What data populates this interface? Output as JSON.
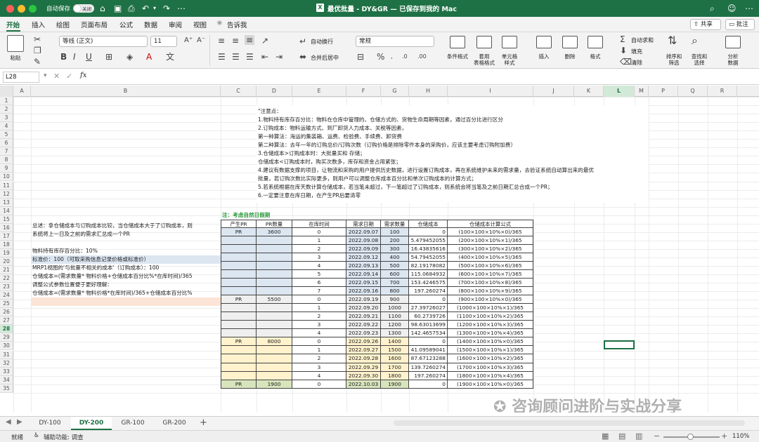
{
  "titlebar": {
    "autosave": "自动保存",
    "autosave_state": "关闭",
    "doc_title": "最优批量 - DY&GR — 已保存到我的 Mac",
    "share": "共享",
    "comment": "批注"
  },
  "ribbon_tabs": [
    "开始",
    "插入",
    "绘图",
    "页面布局",
    "公式",
    "数据",
    "审阅",
    "视图"
  ],
  "tell_me": "告诉我",
  "ribbon": {
    "paste": "粘贴",
    "font_name": "等线 (正文)",
    "font_size": "11",
    "wrap": "自动换行",
    "merge": "合并后居中",
    "number_format": "常规",
    "cond_format": "条件格式",
    "table_format": "套用\n表格格式",
    "cell_style": "单元格\n样式",
    "insert": "插入",
    "delete": "删除",
    "format": "格式",
    "autosum": "自动求和",
    "fill": "填充",
    "clear": "清除",
    "sort": "排序和\n筛选",
    "find": "查找和\n选择",
    "analyze": "分析\n数据"
  },
  "formula_bar": {
    "name_box": "L28",
    "fx": "fx",
    "value": ""
  },
  "columns": [
    "A",
    "B",
    "C",
    "D",
    "E",
    "F",
    "G",
    "H",
    "I",
    "J",
    "K",
    "L",
    "M",
    "P",
    "Q",
    "R"
  ],
  "rows": [
    "1",
    "2",
    "3",
    "4",
    "5",
    "6",
    "7",
    "8",
    "9",
    "10",
    "11",
    "12",
    "13",
    "14",
    "15",
    "16",
    "17",
    "18",
    "19",
    "20",
    "21",
    "22",
    "23",
    "24",
    "25",
    "26",
    "27",
    "28",
    "29",
    "30",
    "31",
    "32",
    "33",
    "34",
    "35"
  ],
  "left_notes": [
    "总述：拿仓储成本与订购成本比较，当仓储成本大于了订购成本，则",
    "系统将上一日及之前的需求汇总成一个PR",
    "物料持有库存百分比：10%",
    "标准价：100（可取采购信息记录价格或标准价）",
    "MRP1视图的'与批量不相关的成本'（订购成本）：100",
    "仓储成本=(需求数量* 物料价格+仓储成本百分比%*在库时间)/365",
    "调整公式参数位置便于更好理解：",
    "仓储成本=(需求数量* 物料价格*在库时间)/365+仓储成本百分比%"
  ],
  "right_notes": [
    "\"注意点：",
    "1.物料持有库存百分比：物料在仓库中管理的、仓储方式的、货物生命周期等因素，通过百分比进行区分",
    "2.订购成本：物料运输方式、到厂卸货人力成本、关税等因素，",
    "第一种算法：海运的集装箱、运费、检验费、手续费、卸货费",
    "第二种算法：去年一年的订购总价/订购次数（订购价格是排除零件本身的采购价，应该主要考虑订购附加费）",
    "3.仓储成本>订购成本时：大批量买和 存储；",
    "仓储成本<订购成本时，购买次数多，库存和资金占用紧张；",
    "4.建议有数据支撑的项目，让物流和采购的用户提供历史数据，进行设置订购成本，再在系统维护未来的需求量，去验证系统自动算出来的最优",
    "批量，若订购次数比实际更多，则用户可以调整仓库成本百分比和单次订购成本的计算方式；",
    "5.若系统根据在库天数计算仓储成本，若当笔未超过，下一笔超过了订购成本，则系统会将当笔及之前日期汇总合成一个PR；",
    "6.一定要注意在库日期，在产生PR后要清零"
  ],
  "table_note": "注：考虑自然日假期",
  "table": {
    "headers": [
      "产生PR",
      "PR数量",
      "在库时间",
      "需求日期",
      "需求数量",
      "仓储成本",
      "仓储成本计算公式"
    ],
    "rows": [
      [
        "PR",
        "3600",
        "0",
        "2022.09.07",
        "100",
        "0",
        "(100×100×10%×0)/365"
      ],
      [
        "",
        "",
        "1",
        "2022.09.08",
        "200",
        "5.479452055",
        "(200×100×10%×1)/365"
      ],
      [
        "",
        "",
        "2",
        "2022.09.09",
        "300",
        "16.43835616",
        "(300×100×10%×2)/365"
      ],
      [
        "",
        "",
        "3",
        "2022.09.12",
        "400",
        "54.79452055",
        "(400×100×10%×5)/365"
      ],
      [
        "",
        "",
        "4",
        "2022.09.13",
        "500",
        "82.19178082",
        "(500×100×10%×6)/365"
      ],
      [
        "",
        "",
        "5",
        "2022.09.14",
        "600",
        "115.0684932",
        "(600×100×10%×7)/365"
      ],
      [
        "",
        "",
        "6",
        "2022.09.15",
        "700",
        "153.4246575",
        "(700×100×10%×8)/365"
      ],
      [
        "",
        "",
        "7",
        "2022.09.16",
        "800",
        "197.260274",
        "(800×100×10%×9)/365"
      ],
      [
        "PR",
        "5500",
        "0",
        "2022.09.19",
        "900",
        "0",
        "(900×100×10%×0)/365"
      ],
      [
        "",
        "",
        "1",
        "2022.09.20",
        "1000",
        "27.39726027",
        "(1000×100×10%×1)/365"
      ],
      [
        "",
        "",
        "2",
        "2022.09.21",
        "1100",
        "60.2739726",
        "(1100×100×10%×2)/365"
      ],
      [
        "",
        "",
        "3",
        "2022.09.22",
        "1200",
        "98.63013699",
        "(1200×100×10%×3)/365"
      ],
      [
        "",
        "",
        "4",
        "2022.09.23",
        "1300",
        "142.4657534",
        "(1300×100×10%×4)/365"
      ],
      [
        "PR",
        "8000",
        "0",
        "2022.09.26",
        "1400",
        "0",
        "(1400×100×10%×0)/365"
      ],
      [
        "",
        "",
        "1",
        "2022.09.27",
        "1500",
        "41.09589041",
        "(1500×100×10%×1)/365"
      ],
      [
        "",
        "",
        "2",
        "2022.09.28",
        "1600",
        "87.67123288",
        "(1600×100×10%×2)/365"
      ],
      [
        "",
        "",
        "3",
        "2022.09.29",
        "1700",
        "139.7260274",
        "(1700×100×10%×3)/365"
      ],
      [
        "",
        "",
        "4",
        "2022.09.30",
        "1800",
        "197.260274",
        "(1800×100×10%×4)/365"
      ],
      [
        "PR",
        "1900",
        "0",
        "2022.10.03",
        "1900",
        "0",
        "(1900×100×10%×0)/365"
      ]
    ],
    "group_colors": [
      "#dce6f1",
      "#efefef",
      "#fff2cc",
      "#d8e4bc"
    ]
  },
  "sheet_tabs": [
    "DY-100",
    "DY-200",
    "GR-100",
    "GR-200"
  ],
  "active_sheet": "DY-200",
  "status": {
    "ready": "就绪",
    "accessibility": "辅助功能: 调查",
    "zoom": "110%"
  },
  "watermark": "咨询顾问进阶与实战分享",
  "colors": {
    "excel_green": "#1e7145",
    "active_tab": "#1e7145"
  }
}
